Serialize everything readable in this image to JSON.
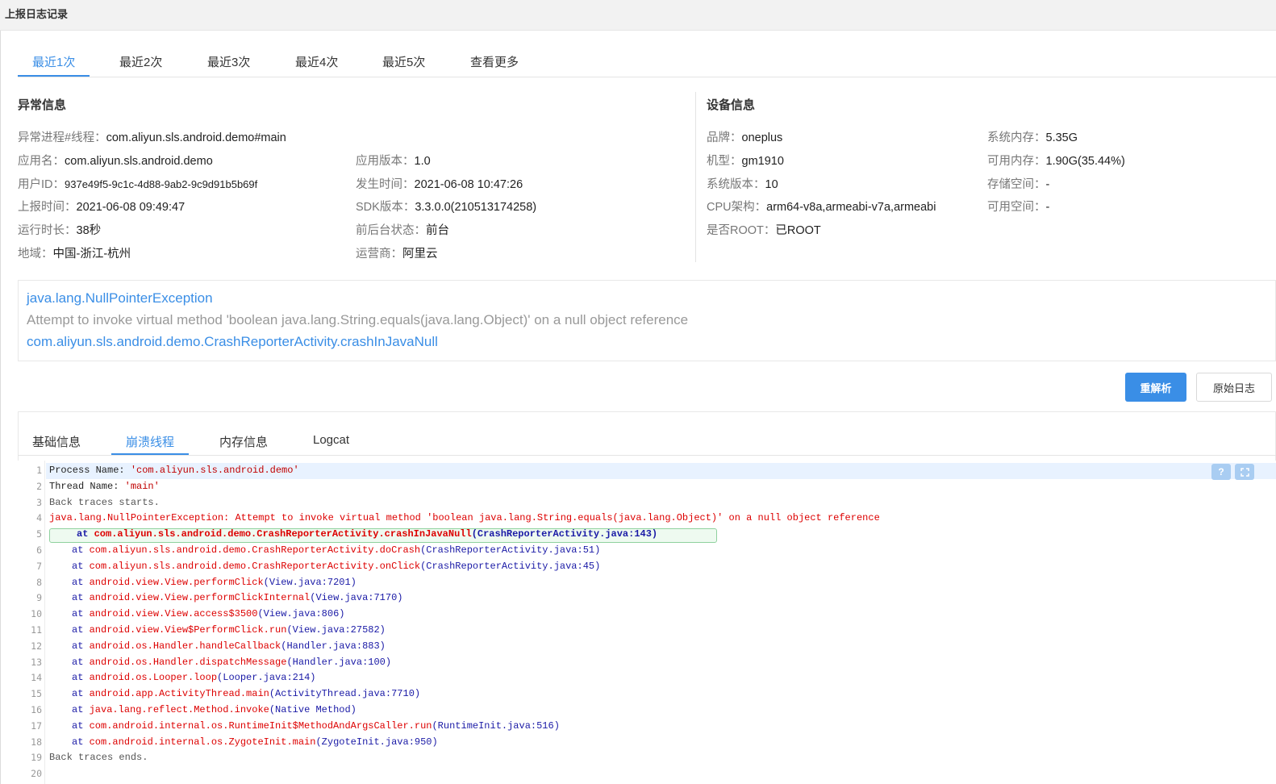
{
  "window": {
    "title": "上报日志记录"
  },
  "top_tabs": [
    {
      "label": "最近1次",
      "active": true
    },
    {
      "label": "最近2次",
      "active": false
    },
    {
      "label": "最近3次",
      "active": false
    },
    {
      "label": "最近4次",
      "active": false
    },
    {
      "label": "最近5次",
      "active": false
    },
    {
      "label": "查看更多",
      "active": false
    }
  ],
  "exception_info": {
    "title": "异常信息",
    "process_thread": {
      "label": "异常进程#线程：",
      "value": "com.aliyun.sls.android.demo#main"
    },
    "app_name": {
      "label": "应用名：",
      "value": "com.aliyun.sls.android.demo"
    },
    "user_id": {
      "label": "用户ID：",
      "value": "937e49f5-9c1c-4d88-9ab2-9c9d91b5b69f"
    },
    "report_time": {
      "label": "上报时间：",
      "value": "2021-06-08 09:49:47"
    },
    "run_duration": {
      "label": "运行时长：",
      "value": "38秒"
    },
    "region": {
      "label": "地域：",
      "value": "中国-浙江-杭州"
    },
    "app_version": {
      "label": "应用版本：",
      "value": "1.0"
    },
    "occur_time": {
      "label": "发生时间：",
      "value": "2021-06-08 10:47:26"
    },
    "sdk_version": {
      "label": "SDK版本：",
      "value": "3.3.0.0(210513174258)"
    },
    "fg_state": {
      "label": "前后台状态：",
      "value": "前台"
    },
    "carrier": {
      "label": "运营商：",
      "value": "阿里云"
    }
  },
  "device_info": {
    "title": "设备信息",
    "brand": {
      "label": "品牌：",
      "value": "oneplus"
    },
    "model": {
      "label": "机型：",
      "value": "gm1910"
    },
    "os_version": {
      "label": "系统版本：",
      "value": "10"
    },
    "cpu_arch": {
      "label": "CPU架构：",
      "value": "arm64-v8a,armeabi-v7a,armeabi"
    },
    "root": {
      "label": "是否ROOT：",
      "value": "已ROOT"
    },
    "sys_memory": {
      "label": "系统内存：",
      "value": "5.35G"
    },
    "avail_memory": {
      "label": "可用内存：",
      "value": "1.90G(35.44%)"
    },
    "storage": {
      "label": "存储空间：",
      "value": "-"
    },
    "avail_space": {
      "label": "可用空间：",
      "value": "-"
    }
  },
  "exception_summary": {
    "type": "java.lang.NullPointerException",
    "message": "Attempt to invoke virtual method 'boolean java.lang.String.equals(java.lang.Object)' on a null object reference",
    "location": "com.aliyun.sls.android.demo.CrashReporterActivity.crashInJavaNull"
  },
  "actions": {
    "reparse": "重解析",
    "raw_log": "原始日志"
  },
  "sub_tabs": [
    {
      "label": "基础信息",
      "active": false
    },
    {
      "label": "崩溃线程",
      "active": true
    },
    {
      "label": "内存信息",
      "active": false
    },
    {
      "label": "Logcat",
      "active": false
    }
  ],
  "editor": {
    "help_icon_text": "?",
    "line_numbers": [
      "1",
      "2",
      "3",
      "4",
      "5",
      "6",
      "7",
      "8",
      "9",
      "10",
      "11",
      "12",
      "13",
      "14",
      "15",
      "16",
      "17",
      "18",
      "19",
      "20"
    ],
    "lines": {
      "l1": {
        "a": "Process Name: ",
        "b": "'com.aliyun.sls.android.demo'"
      },
      "l2": {
        "a": "Thread Name: ",
        "b": "'main'"
      },
      "l3": {
        "a": "Back traces starts."
      },
      "l4": {
        "a": "java.lang.NullPointerException: Attempt to invoke virtual method 'boolean java.lang.String.equals(java.lang.Object)' on a null object reference"
      },
      "frames": [
        {
          "at": "at ",
          "method": "com.aliyun.sls.android.demo.CrashReporterActivity.crashInJavaNull",
          "loc": "(CrashReporterActivity.java:143)"
        },
        {
          "at": "at ",
          "method": "com.aliyun.sls.android.demo.CrashReporterActivity.doCrash",
          "loc": "(CrashReporterActivity.java:51)"
        },
        {
          "at": "at ",
          "method": "com.aliyun.sls.android.demo.CrashReporterActivity.onClick",
          "loc": "(CrashReporterActivity.java:45)"
        },
        {
          "at": "at ",
          "method": "android.view.View.performClick",
          "loc": "(View.java:7201)"
        },
        {
          "at": "at ",
          "method": "android.view.View.performClickInternal",
          "loc": "(View.java:7170)"
        },
        {
          "at": "at ",
          "method": "android.view.View.access$3500",
          "loc": "(View.java:806)"
        },
        {
          "at": "at ",
          "method": "android.view.View$PerformClick.run",
          "loc": "(View.java:27582)"
        },
        {
          "at": "at ",
          "method": "android.os.Handler.handleCallback",
          "loc": "(Handler.java:883)"
        },
        {
          "at": "at ",
          "method": "android.os.Handler.dispatchMessage",
          "loc": "(Handler.java:100)"
        },
        {
          "at": "at ",
          "method": "android.os.Looper.loop",
          "loc": "(Looper.java:214)"
        },
        {
          "at": "at ",
          "method": "android.app.ActivityThread.main",
          "loc": "(ActivityThread.java:7710)"
        },
        {
          "at": "at ",
          "method": "java.lang.reflect.Method.invoke",
          "loc": "(Native Method)"
        },
        {
          "at": "at ",
          "method": "com.android.internal.os.RuntimeInit$MethodAndArgsCaller.run",
          "loc": "(RuntimeInit.java:516)"
        },
        {
          "at": "at ",
          "method": "com.android.internal.os.ZygoteInit.main",
          "loc": "(ZygoteInit.java:950)"
        }
      ],
      "l19": {
        "a": "Back traces ends."
      }
    }
  },
  "colors": {
    "accent": "#3a8ee6",
    "error_red": "#dd0000",
    "link_blue": "#1a1aa6"
  }
}
